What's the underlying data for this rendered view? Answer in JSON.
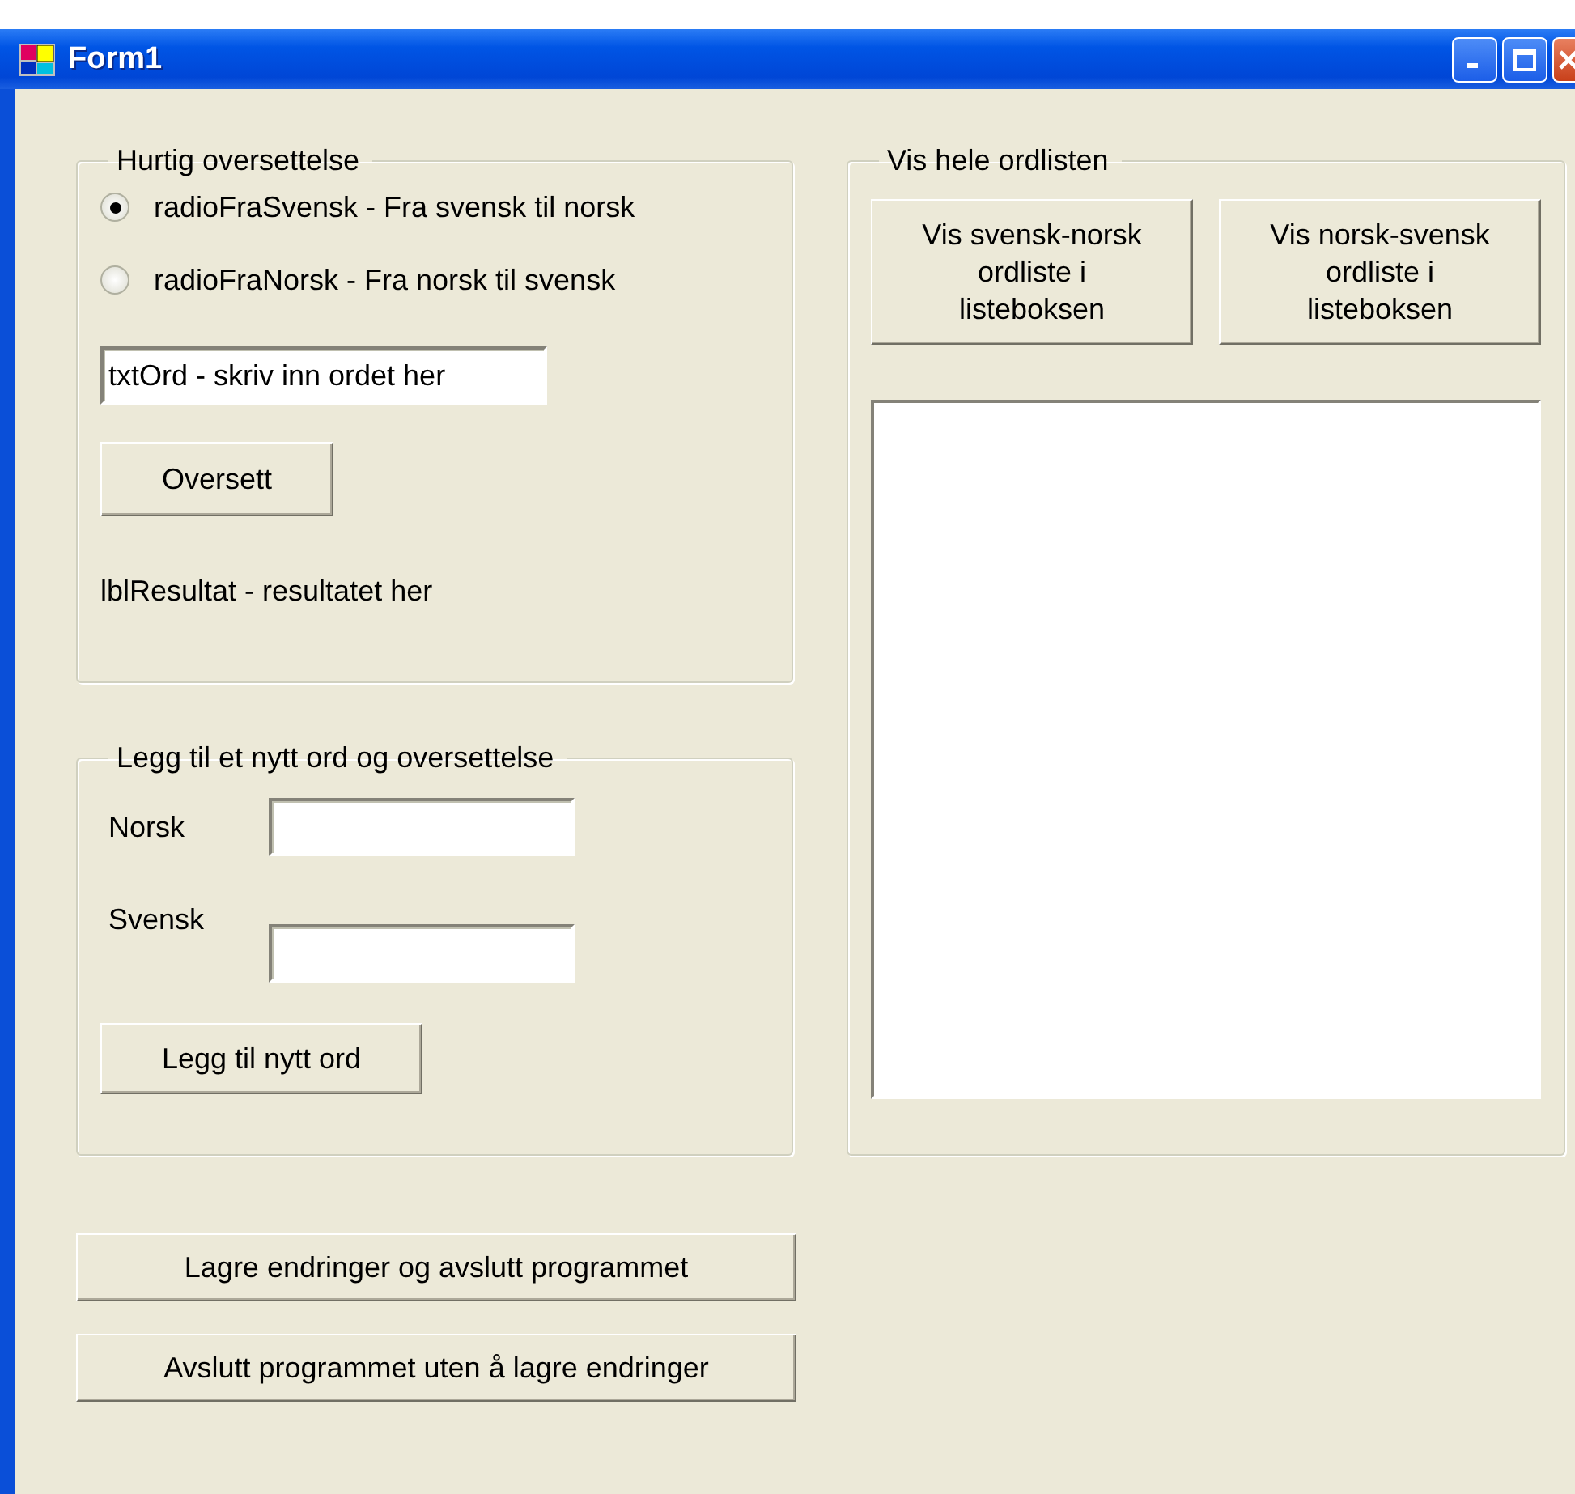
{
  "window": {
    "title": "Form1"
  },
  "quick_translate": {
    "title": "Hurtig oversettelse",
    "options": [
      {
        "label": "radioFraSvensk - Fra svensk til norsk",
        "selected": true
      },
      {
        "label": "radioFraNorsk - Fra norsk til svensk",
        "selected": false
      }
    ],
    "word_field": {
      "value": "txtOrd - skriv inn ordet her"
    },
    "translate_button": "Oversett",
    "result_label": "lblResultat - resultatet her"
  },
  "add_word": {
    "title": "Legg til et nytt ord og oversettelse",
    "fields": [
      {
        "label": "Norsk"
      },
      {
        "label": "Svensk"
      }
    ],
    "add_button": "Legg til nytt ord"
  },
  "word_list": {
    "title": "Vis hele ordlisten",
    "buttons": [
      "Vis svensk-norsk ordliste i listeboksen",
      "Vis norsk-svensk ordliste i listeboksen"
    ]
  },
  "bottom_buttons": [
    "Lagre endringer og avslutt programmet",
    "Avslutt programmet uten å lagre endringer"
  ]
}
